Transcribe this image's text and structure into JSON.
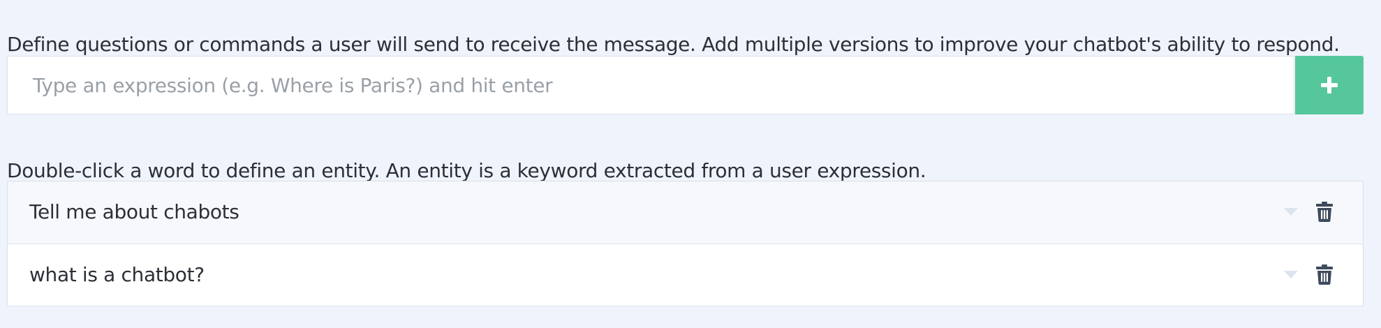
{
  "expressions_section": {
    "description": "Define questions or commands a user will send to receive the message. Add multiple versions to improve your chatbot's ability to respond.",
    "input": {
      "value": "",
      "placeholder": "Type an expression (e.g. Where is Paris?) and hit enter"
    },
    "add_button_icon": "plus-icon",
    "entity_help": "Double-click a word to define an entity. An entity is a keyword extracted from a user expression.",
    "items": [
      {
        "text": "Tell me about chabots",
        "toggle_icon": "chevron-down-icon",
        "delete_icon": "trash-icon"
      },
      {
        "text": "what is a chatbot?",
        "toggle_icon": "chevron-down-icon",
        "delete_icon": "trash-icon"
      }
    ]
  },
  "colors": {
    "page_background": "#eff3fb",
    "accent_green": "#56c79b",
    "text": "#2b2f36",
    "placeholder": "#9aa0a8",
    "border": "#d9e1ec",
    "row_alt_background": "#f6f8fc",
    "icon_dark": "#3e4a5c",
    "icon_faint": "#dbe3ee"
  }
}
